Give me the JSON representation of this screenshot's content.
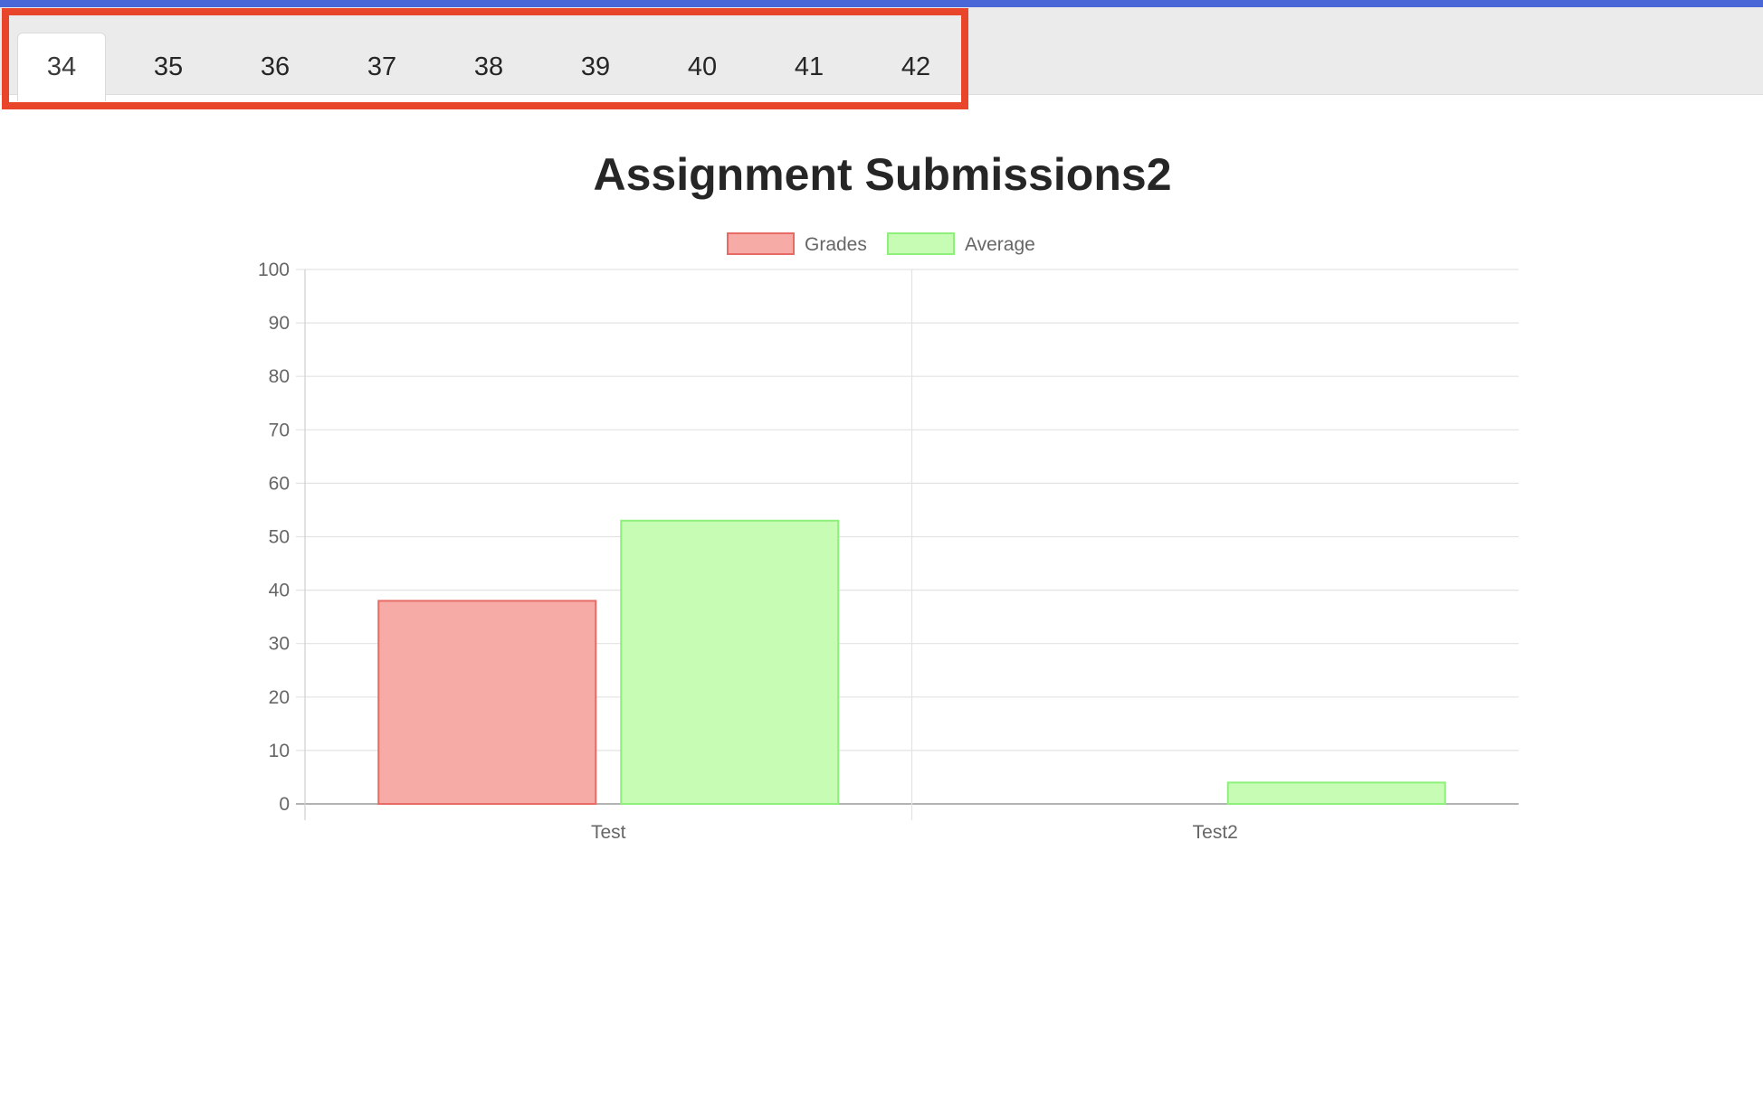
{
  "tabs": [
    {
      "label": "34",
      "active": true
    },
    {
      "label": "35",
      "active": false
    },
    {
      "label": "36",
      "active": false
    },
    {
      "label": "37",
      "active": false
    },
    {
      "label": "38",
      "active": false
    },
    {
      "label": "39",
      "active": false
    },
    {
      "label": "40",
      "active": false
    },
    {
      "label": "41",
      "active": false
    },
    {
      "label": "42",
      "active": false
    }
  ],
  "colors": {
    "topbar": "#4a67d8",
    "highlight": "#e8452a",
    "grades_fill": "#f6aba7",
    "grades_stroke": "#e86a64",
    "average_fill": "#c6fcb3",
    "average_stroke": "#8ef07a"
  },
  "chart_data": {
    "type": "bar",
    "title": "Assignment Submissions2",
    "categories": [
      "Test",
      "Test2"
    ],
    "series": [
      {
        "name": "Grades",
        "values": [
          38,
          0
        ]
      },
      {
        "name": "Average",
        "values": [
          53,
          4
        ]
      }
    ],
    "ylim": [
      0,
      100
    ],
    "yticks": [
      "0",
      "10",
      "20",
      "30",
      "40",
      "50",
      "60",
      "70",
      "80",
      "90",
      "100"
    ],
    "legend_position": "top-center",
    "grid": true
  }
}
